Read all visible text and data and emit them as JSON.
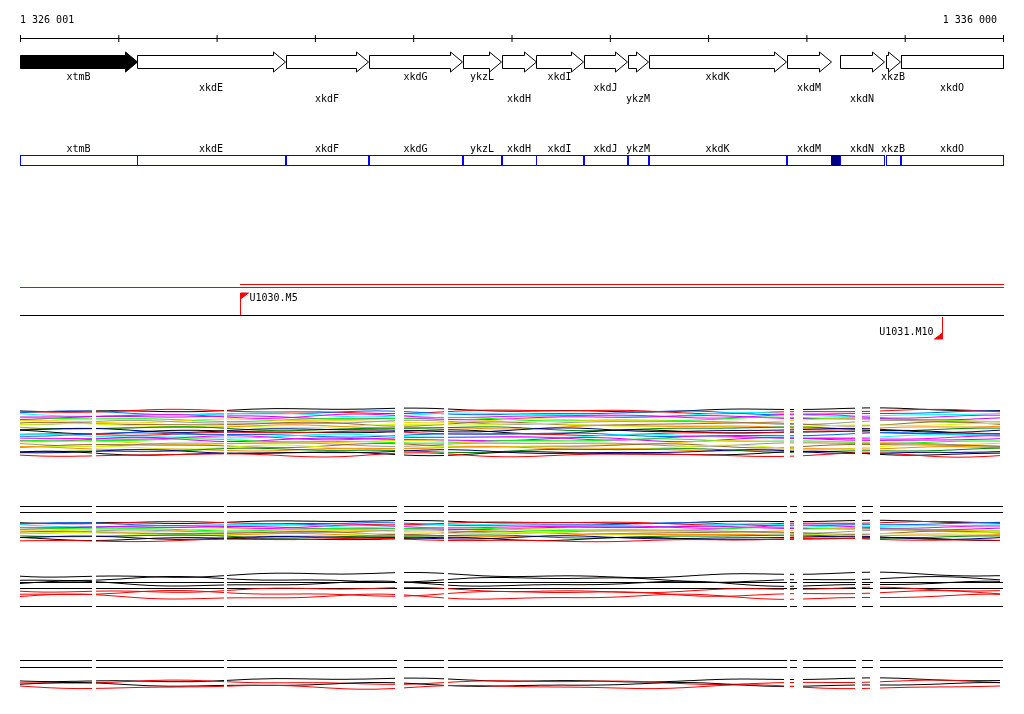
{
  "ruler": {
    "start_label": "1 326 001",
    "end_label": "1 336 000"
  },
  "genes": [
    {
      "name": "xtmB",
      "kind": "arrow",
      "selected": true
    },
    {
      "name": "xkdE",
      "kind": "arrow",
      "selected": false
    },
    {
      "name": "xkdF",
      "kind": "arrow",
      "selected": false
    },
    {
      "name": "xkdG",
      "kind": "arrow",
      "selected": false
    },
    {
      "name": "ykzL",
      "kind": "arrow",
      "selected": false
    },
    {
      "name": "xkdH",
      "kind": "arrow",
      "selected": false
    },
    {
      "name": "xkdI",
      "kind": "arrow",
      "selected": false
    },
    {
      "name": "xkdJ",
      "kind": "arrow",
      "selected": false
    },
    {
      "name": "ykzM",
      "kind": "arrow",
      "selected": false
    },
    {
      "name": "xkdK",
      "kind": "arrow",
      "selected": false
    },
    {
      "name": "xkdM",
      "kind": "arrow",
      "selected": false
    },
    {
      "name": "xkdN",
      "kind": "arrow",
      "selected": false
    },
    {
      "name": "xkzB",
      "kind": "arrow",
      "selected": false
    },
    {
      "name": "xkdO",
      "kind": "box",
      "selected": false
    }
  ],
  "segments": [
    "xtmB",
    "xkdE",
    "xkdF",
    "xkdG",
    "ykzL",
    "xkdH",
    "xkdI",
    "xkdJ",
    "ykzM",
    "xkdK",
    "xkdM",
    "xkdN",
    "xkzB",
    "xkdO"
  ],
  "markers": [
    {
      "label": "U1030.M5",
      "kind": "upper"
    },
    {
      "label": "U1031.M10",
      "kind": "lower"
    }
  ]
}
